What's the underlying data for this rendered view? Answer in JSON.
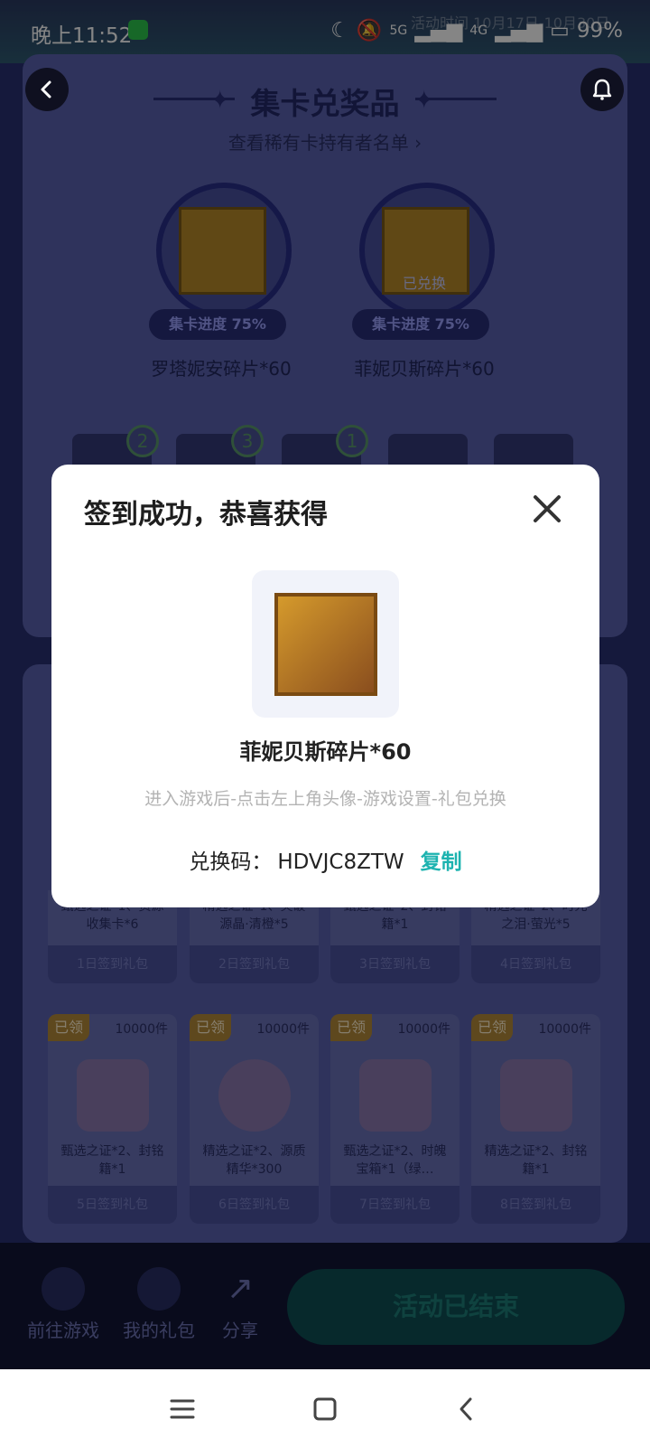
{
  "status_bar": {
    "time": "晚上11:52",
    "battery": "99%",
    "network_1": "5G",
    "network_2": "4G"
  },
  "background": {
    "activity_time": "活动时间 10月17日-10月30日",
    "section_title": "集卡兑奖品",
    "section_subtitle": "查看稀有卡持有者名单",
    "prizes": [
      {
        "progress": "集卡进度 75%",
        "name": "罗塔妮安碎片*60",
        "redeemed": ""
      },
      {
        "progress": "集卡进度 75%",
        "name": "菲妮贝斯碎片*60",
        "redeemed": "已兑换"
      }
    ],
    "card_badges": [
      "2",
      "3",
      "1"
    ],
    "gifts_row1": [
      {
        "desc": "甄选之证*1、资源收集卡*6",
        "day": "1日签到礼包"
      },
      {
        "desc": "精选之证*1、突破源晶·清橙*5",
        "day": "2日签到礼包"
      },
      {
        "desc": "甄选之证*2、封铭籍*1",
        "day": "3日签到礼包"
      },
      {
        "desc": "精选之证*2、时光之泪·萤光*5",
        "day": "4日签到礼包"
      }
    ],
    "gifts_row2": [
      {
        "tag": "已领",
        "count": "10000件",
        "desc": "甄选之证*2、封铭籍*1",
        "day": "5日签到礼包"
      },
      {
        "tag": "已领",
        "count": "10000件",
        "desc": "精选之证*2、源质精华*300",
        "day": "6日签到礼包"
      },
      {
        "tag": "已领",
        "count": "10000件",
        "desc": "甄选之证*2、时魄宝箱*1（绿…",
        "day": "7日签到礼包"
      },
      {
        "tag": "已领",
        "count": "10000件",
        "desc": "精选之证*2、封铭籍*1",
        "day": "8日签到礼包"
      }
    ]
  },
  "bottom_bar": {
    "go_game": "前往游戏",
    "my_gifts": "我的礼包",
    "share": "分享",
    "end_button": "活动已结束"
  },
  "modal": {
    "title": "签到成功，恭喜获得",
    "reward_name": "菲妮贝斯碎片*60",
    "hint": "进入游戏后-点击左上角头像-游戏设置-礼包兑换",
    "code_label": "兑换码：",
    "code_value": "HDVJC8ZTW",
    "copy_label": "复制"
  },
  "colors": {
    "accent": "#1db3b0",
    "modal_bg": "#ffffff"
  }
}
